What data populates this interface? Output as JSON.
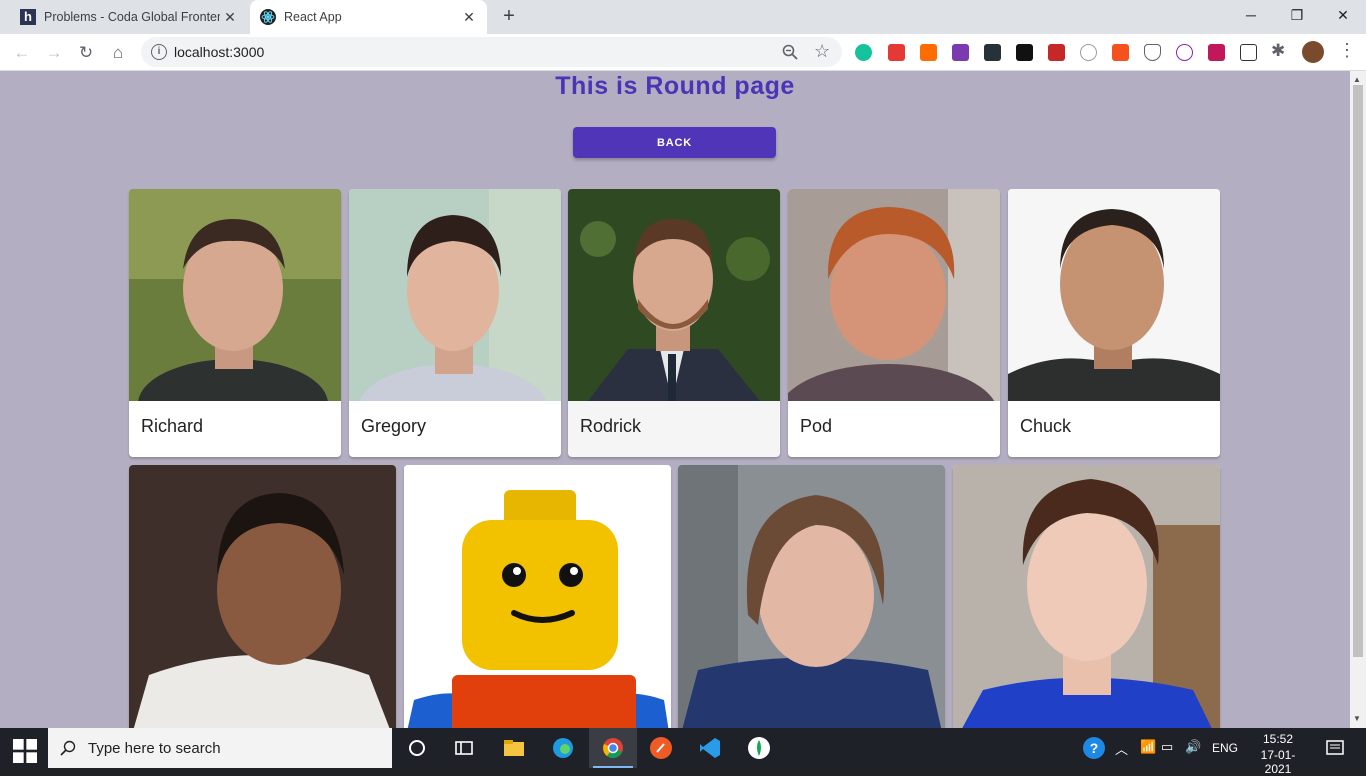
{
  "browser": {
    "tabs": [
      {
        "title": "Problems - Coda Global Frontend",
        "favicon": "h"
      },
      {
        "title": "React App",
        "favicon": "react-icon"
      }
    ],
    "new_tab": "+",
    "window_controls": {
      "minimize": "─",
      "maximize": "❐",
      "close": "✕"
    },
    "url": "localhost:3000"
  },
  "page": {
    "title": "This is Round page",
    "back_label": "BACK",
    "cards_row1": [
      {
        "name": "Richard"
      },
      {
        "name": "Gregory"
      },
      {
        "name": "Rodrick"
      },
      {
        "name": "Pod"
      },
      {
        "name": "Chuck"
      }
    ]
  },
  "taskbar": {
    "search_placeholder": "Type here to search",
    "language": "ENG",
    "time": "15:52",
    "date": "17-01-2021"
  }
}
